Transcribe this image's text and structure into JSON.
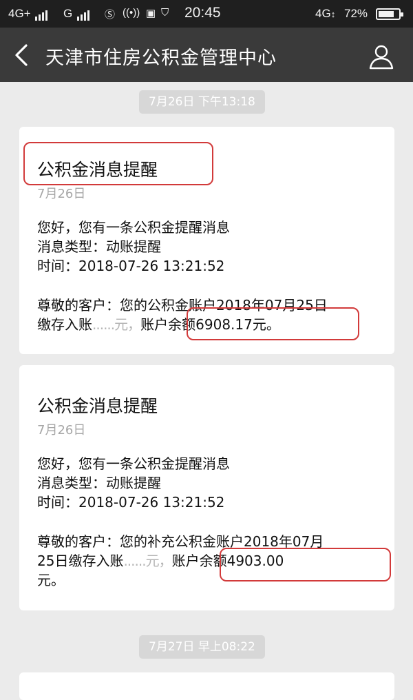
{
  "status_bar": {
    "network_left": "4G+",
    "network_mid": "G",
    "time": "20:45",
    "network_right": "4G",
    "battery": "72%"
  },
  "header": {
    "title": "天津市住房公积金管理中心",
    "back_icon": "chevron-left-icon",
    "profile_icon": "user-icon"
  },
  "timestamps": [
    "7月26日 下午13:18",
    "7月27日 早上08:22"
  ],
  "messages": [
    {
      "title": "公积金消息提醒",
      "date": "7月26日",
      "greeting": "您好，您有一条公积金提醒消息",
      "type": "消息类型：动账提醒",
      "time": "时间：2018-07-26 13:21:52",
      "body_line1": "尊敬的客户：您的公积金账户2018年07月25日",
      "body_line2_prefix": "缴存入账",
      "body_line2_masked": "......元，",
      "body_line2_balance": "账户余额6908.17元。"
    },
    {
      "title": "公积金消息提醒",
      "date": "7月26日",
      "greeting": "您好，您有一条公积金提醒消息",
      "type": "消息类型：动账提醒",
      "time": "时间：2018-07-26 13:21:52",
      "body_line1": "尊敬的客户：您的补充公积金账户2018年07月",
      "body_line2_prefix": "25日缴存入账",
      "body_line2_masked": "......元，",
      "body_line2_balance": "账户余额4903.00",
      "body_line3": "元。"
    }
  ],
  "colors": {
    "header_bg": "#3a3a3a",
    "status_bg": "#1f1f1f",
    "page_bg": "#ebebeb",
    "highlight": "#d23a3a"
  }
}
